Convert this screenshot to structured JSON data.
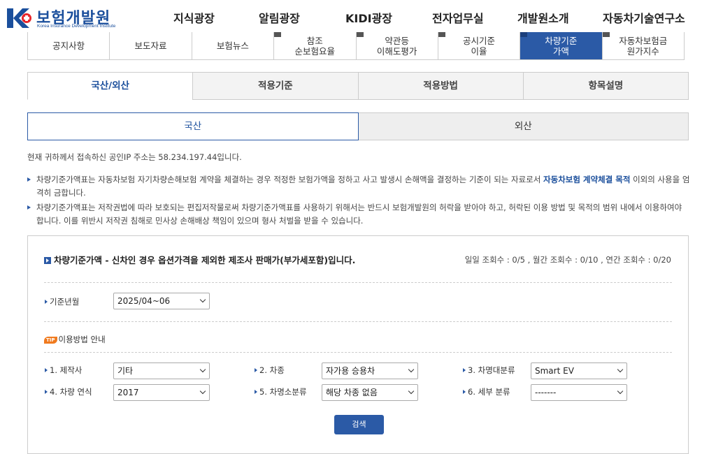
{
  "brand": {
    "logo_ko": "보험개발원",
    "logo_en": "Korea Insurance Development Institute",
    "colors": {
      "primary": "#2b5aa6",
      "accent": "#f07a1e"
    }
  },
  "gnb": [
    "지식광장",
    "알림광장",
    "KIDI광장",
    "전자업무실",
    "개발원소개",
    "자동차기술연구소"
  ],
  "subnav": [
    {
      "line1": "공지사항",
      "line2": ""
    },
    {
      "line1": "보도자료",
      "line2": ""
    },
    {
      "line1": "보험뉴스",
      "line2": ""
    },
    {
      "line1": "참조",
      "line2": "순보험요율"
    },
    {
      "line1": "약관등",
      "line2": "이해도평가"
    },
    {
      "line1": "공시기준",
      "line2": "이율"
    },
    {
      "line1": "차량기준",
      "line2": "가액"
    },
    {
      "line1": "자동차보험금",
      "line2": "원가지수"
    }
  ],
  "tabs": [
    "국산/외산",
    "적용기준",
    "적용방법",
    "항목설명"
  ],
  "subtabs": [
    "국산",
    "외산"
  ],
  "ip_notice": "현재 귀하께서 접속하신 공인IP 주소는 58.234.197.44입니다.",
  "notices": [
    {
      "pre": "차량기준가액표는 자동차보험 자기차량손해보험 계약을 체결하는 경우 적정한 보험가액을 정하고 사고 발생시 손해액을 결정하는 기준이 되는 자료로서 ",
      "hl": "자동차보험 계약체결 목적",
      "post": " 이외의 사용을 엄격히 금합니다."
    },
    {
      "pre": "차량기준가액표는 저작권법에 따라 보호되는 편집저작물로써 차량기준가액표를 사용하기 위해서는 반드시 보험개발원의 허락을 받아야 하고, 허락된 이용 방법 및 목적의 범위 내에서 이용하여야 합니다. 이를 위반시 저작권 침해로 민사상 손해배상 책임이 있으며 형사 처벌을 받을 수 있습니다.",
      "hl": "",
      "post": ""
    }
  ],
  "search": {
    "title": "차량기준가액 - 신차인 경우 옵션가격을 제외한 제조사 판매가(부가세포함)입니다.",
    "counts": "일일 조회수 : 0/5 , 월간 조회수 : 0/10 , 연간 조회수 : 0/20",
    "base_label": "기준년월",
    "base_value": "2025/04~06",
    "tip_tag": "TIP",
    "tip_text": "이용방법 안내",
    "fields": [
      {
        "label": "1. 제작사",
        "value": "기타"
      },
      {
        "label": "2. 차종",
        "value": "자가용 승용차"
      },
      {
        "label": "3. 차명대분류",
        "value": "Smart EV"
      },
      {
        "label": "4. 차량 연식",
        "value": "2017"
      },
      {
        "label": "5. 차명소분류",
        "value": "해당 차종 없음"
      },
      {
        "label": "6. 세부 분류",
        "value": "-------"
      }
    ],
    "button": "검색"
  }
}
